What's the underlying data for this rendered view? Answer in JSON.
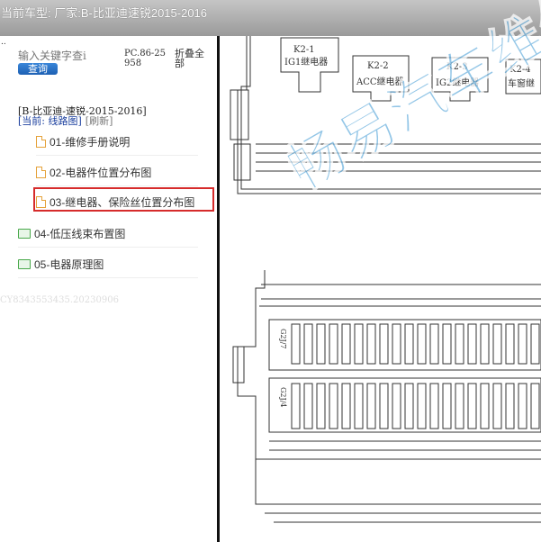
{
  "header": {
    "title": "当前车型:   厂家:B-比亚迪速锐2015-2016"
  },
  "sidebar": {
    "dots": "..",
    "search_placeholder": "输入关键字查i",
    "query_label": "查询",
    "code": "PC.86-25958",
    "collapse_label": "折叠全部",
    "model_line": "[B-比亚迪-速锐-2015-2016]",
    "current_label": "[当前: 线路图]",
    "refresh_label": "[刷新]",
    "items": [
      {
        "label": "01-维修手册说明",
        "type": "file"
      },
      {
        "label": "02-电器件位置分布图",
        "type": "file"
      },
      {
        "label": "03-继电器、保险丝位置分布图",
        "type": "file",
        "selected": true
      },
      {
        "label": "04-低压线束布置图",
        "type": "folder"
      },
      {
        "label": "05-电器原理图",
        "type": "folder"
      }
    ],
    "footer_id": "CY8343553435.20230906"
  },
  "diagram": {
    "relays": [
      {
        "id": "K2-1",
        "name": "IG1继电器"
      },
      {
        "id": "K2-2",
        "name": "ACC继电器"
      },
      {
        "id": "K2-3",
        "name": "IG2继电器"
      },
      {
        "id": "K2-4",
        "name": "车窗继"
      }
    ],
    "connector_labels": [
      "G2J/7",
      "G2J/4"
    ],
    "watermark": "畅易汽车维修"
  }
}
